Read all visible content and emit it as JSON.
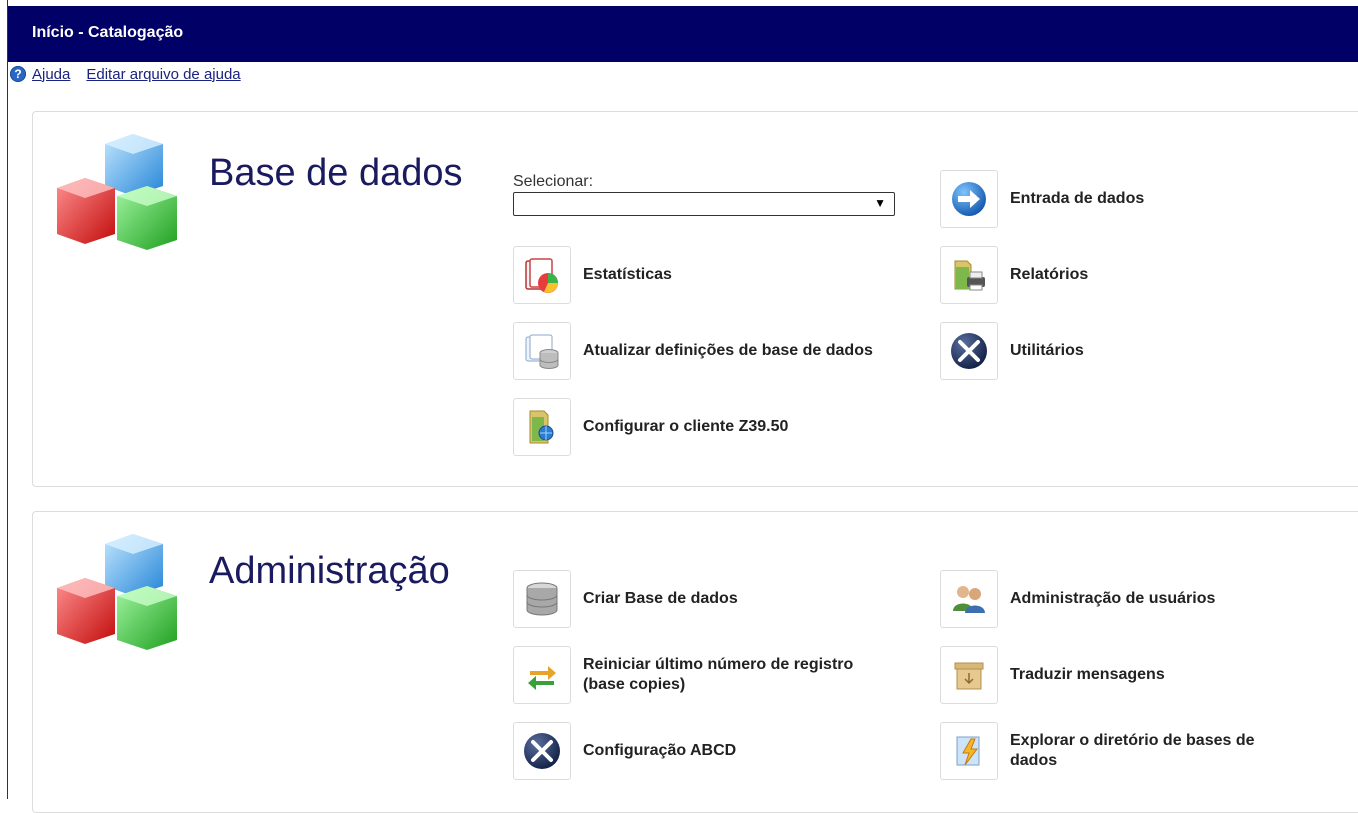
{
  "header": {
    "title": "Início - Catalogação"
  },
  "help": {
    "help_link": "Ajuda",
    "edit_help_link": "Editar arquivo de ajuda"
  },
  "database_section": {
    "title": "Base de dados",
    "select_label": "Selecionar:",
    "select_value": "",
    "items": [
      {
        "label": "Entrada de dados",
        "icon": "arrow-right-icon"
      },
      {
        "label": "Estatísticas",
        "icon": "statistics-chart-icon"
      },
      {
        "label": "Relatórios",
        "icon": "reports-folder-printer-icon"
      },
      {
        "label": "Atualizar definições de base de dados",
        "icon": "database-definitions-icon"
      },
      {
        "label": "Utilitários",
        "icon": "tools-icon"
      },
      {
        "label": "Configurar o cliente Z39.50",
        "icon": "z3950-client-folder-icon"
      }
    ]
  },
  "admin_section": {
    "title": "Administração",
    "items": [
      {
        "label": "Criar Base de dados",
        "icon": "database-stack-icon"
      },
      {
        "label": "Administração de usuários",
        "icon": "users-icon"
      },
      {
        "label": "Reiniciar último número de registro (base copies)",
        "icon": "refresh-arrows-icon"
      },
      {
        "label": "Traduzir mensagens",
        "icon": "box-icon"
      },
      {
        "label": "Configuração ABCD",
        "icon": "tools-icon"
      },
      {
        "label": "Explorar o diretório de bases de dados",
        "icon": "directory-explorer-icon"
      }
    ]
  }
}
